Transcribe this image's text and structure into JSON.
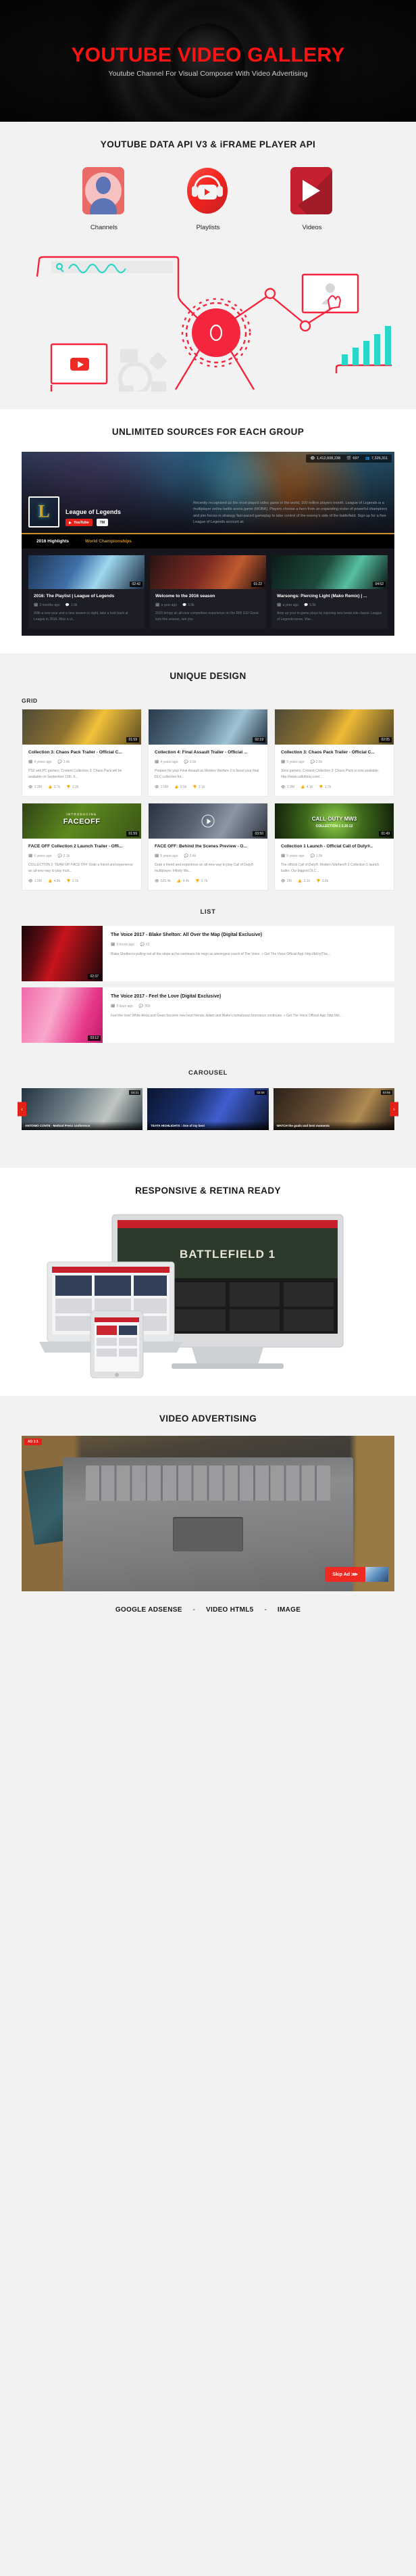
{
  "hero": {
    "title": "YOUTUBE VIDEO GALLERY",
    "subtitle": "Youtube Channel For Visual Composer With Video Advertising"
  },
  "api_section": {
    "title": "YOUTUBE DATA API V3 & iFRAME PLAYER API",
    "items": [
      {
        "label": "Channels",
        "icon": "channel-avatar-icon"
      },
      {
        "label": "Playlists",
        "icon": "headphones-playlist-icon"
      },
      {
        "label": "Videos",
        "icon": "play-button-icon"
      }
    ]
  },
  "sources_section": {
    "title": "UNLIMITED SOURCES FOR EACH GROUP",
    "channel": {
      "name": "League of Legends",
      "badge": "YouTube",
      "subscribers": "7M",
      "description": "Recently recognized as the most played video game in the world, 100 million players month. League of Legends is a multiplayer online battle arena game (MOBA). Players choose a hero from an expanding roster of powerful champions and join forces in strategy fast-paced gameplay to take control of the enemy's side of the battlefield. Sign up for a free League of Legends account at:",
      "stats": {
        "views": "1,412,608,238",
        "videos": "697",
        "subs": "7,326,311"
      }
    },
    "tabs": [
      {
        "label": "2016 Highlights",
        "active": true
      },
      {
        "label": "World Championships",
        "active": false
      }
    ],
    "videos": [
      {
        "title": "2016: The Playlist | League of Legends",
        "duration": "02:42",
        "age": "2 months ago",
        "comments": "1.6k",
        "text": "With a new year and a new season in sight, take a look back at League in 2016. Miss a vi..."
      },
      {
        "title": "Welcome to the 2016 season",
        "duration": "01:22",
        "age": "a year ago",
        "comments": "5.5k",
        "text": "2016 brings an all-new competitive experience on the Rift! GG! Good luck this season, see you"
      },
      {
        "title": "Warsongs: Piercing Light (Mako Remix) | ...",
        "duration": "04:52",
        "age": "a year ago",
        "comments": "5.5k",
        "text": "Amp up your in-game plays by injecting new beats into classic League of Legends tunes. War..."
      }
    ]
  },
  "design_section": {
    "title": "UNIQUE DESIGN",
    "grid_label": "GRID",
    "list_label": "LIST",
    "carousel_label": "CAROUSEL",
    "grid_cards": [
      {
        "title": "Collection 3: Chaos Pack Trailer - Official C...",
        "duration": "01:59",
        "age": "4 years ago",
        "comments": "1.4k",
        "text": "PS3 and PC gamers, Content Collection 3: Chaos Pack will be available on September 12th. It...",
        "views": "1.3M",
        "likes": "3.7k",
        "dislikes": "1.2k",
        "art": "art-cod1"
      },
      {
        "title": "Collection 4: Final Assault Trailer - Official ...",
        "duration": "02:19",
        "age": "4 years ago",
        "comments": "3.6k",
        "text": "Prepare for your Final Assault as Modern Warfare 3 is faced your final DLC collection for...",
        "views": "2.6M",
        "likes": "5.5k",
        "dislikes": "2.1k",
        "art": "art-cod2"
      },
      {
        "title": "Collection 3: Chaos Pack Trailer - Official C...",
        "duration": "02:05",
        "age": "5 years ago",
        "comments": "2.5k",
        "text": "Xbox gamers, Content Collection 3: Chaos Pack is now available. http://www.callofduty.com/...",
        "views": "1.9M",
        "likes": "4.1k",
        "dislikes": "1.7k",
        "art": "art-cod3"
      },
      {
        "title": "FACE OFF Collection 2 Launch Trailer - Offi...",
        "duration": "01:59",
        "age": "5 years ago",
        "comments": "2.1k",
        "text": "COLLECTION 2: TEAM UP. FACE OFF. Grab a friend and experience an all-new way to play mult...",
        "views": "1.5M",
        "likes": "4.8k",
        "dislikes": "2.1k",
        "art": "art-face",
        "art_text": "FACEOFF",
        "art_small": "INTRODUCING"
      },
      {
        "title": "FACE OFF: Behind the Scenes Preview - O...",
        "duration": "03:50",
        "age": "5 years ago",
        "comments": "2.4k",
        "text": "Grab a friend and experience an all-new way to play Call of Duty® multiplayer. Infinity Wa...",
        "views": "525.4k",
        "likes": "4.4k",
        "dislikes": "2.7k",
        "art": "art-bts",
        "has_play": true
      },
      {
        "title": "Collection 1 Launch - Official Call of Duty®..",
        "duration": "01:49",
        "age": "5 years ago",
        "comments": "1.5k",
        "text": "The official Call of Duty®: Modern Warfare® 3 Collection 1 launch trailer. Our biggest DLC...",
        "views": "2M",
        "likes": "3.1k",
        "dislikes": "3.6k",
        "art": "art-mw3",
        "art_text": "CALL·DUTY MW3",
        "art_small": "COLLECTION 1  3.20.12"
      }
    ],
    "list_items": [
      {
        "title": "The Voice 2017 - Blake Shelton: All Over the Map (Digital Exclusive)",
        "duration": "02:37",
        "age": "3 hours ago",
        "comments": "62",
        "text": "Blake Shelton is pulling out all the stops as he continues his reign as winningest coach of The Voice. » Get The Voice Official App: http://bit.ly/The...",
        "art": "art-voice1"
      },
      {
        "title": "The Voice 2017 - Feel the Love (Digital Exclusive)",
        "duration": "03:12",
        "age": "9 days ago",
        "comments": "359",
        "text": "Feel the love! While Alicia and Gwen become new best friends, Adam and Blake's tumultuous bromance continues. » Get The Voice Official App: http://bit...",
        "art": "art-voice2"
      }
    ],
    "carousel_slides": [
      {
        "caption": "ANTONIO CONTE - Method Press conference",
        "duration": "04:21",
        "art": "art-c1"
      },
      {
        "caption": "TEATA HIGHLIGHTS : One of my best",
        "duration": "02:08",
        "art": "art-c2"
      },
      {
        "caption": "WATCH the goals and best moments",
        "duration": "03:55",
        "art": "art-c3"
      }
    ],
    "carousel_prev": "‹",
    "carousel_next": "›"
  },
  "responsive_section": {
    "title": "RESPONSIVE & RETINA READY",
    "screen_text": "BATTLEFIELD 1"
  },
  "advertising_section": {
    "title": "VIDEO ADVERTISING",
    "ad_label": "AD 1:1",
    "skip_label": "Skip Ad ⋙",
    "footer": [
      "GOOGLE ADSENSE",
      "VIDEO HTML5",
      "IMAGE"
    ],
    "separator": "-"
  },
  "icons": {
    "calendar": "🗓",
    "comment": "💬",
    "eye": "👁",
    "thumb_up": "👍",
    "thumb_down": "👎",
    "video": "🎬",
    "people": "👥"
  },
  "colors": {
    "brand_red": "#fd1212",
    "accent_red": "#e32119",
    "dark_bg": "#11111a",
    "page_bg": "#f2f2f2",
    "gold": "#c8922a"
  }
}
